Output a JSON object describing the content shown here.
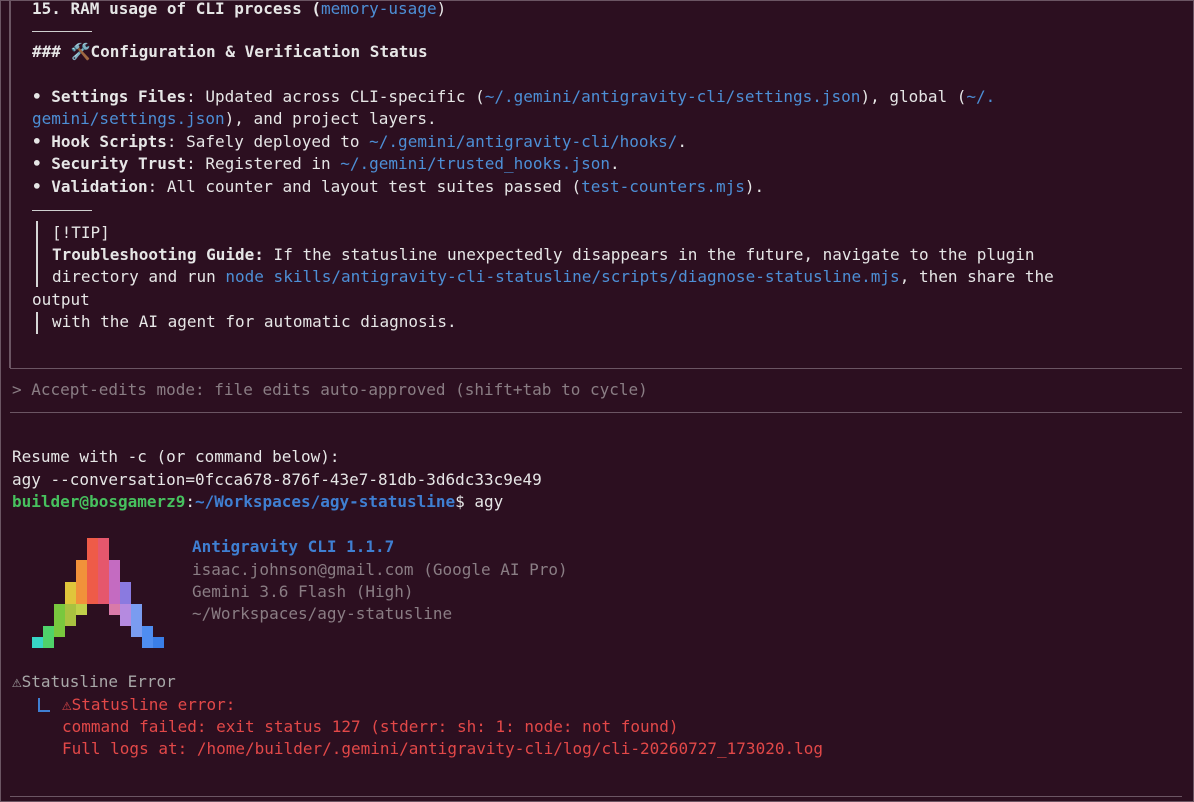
{
  "colors": {
    "background": "#2c0f20",
    "link": "#4d8fd6",
    "prompt_user": "#47c15e",
    "prompt_path": "#3f7fd2",
    "error": "#e24848",
    "dim": "#8a7d84"
  },
  "top": {
    "item15_prefix": "15. RAM usage of CLI process (",
    "item15_link": "memory-usage",
    "item15_suffix": ")"
  },
  "config": {
    "heading": "### 🛠️Configuration & Verification Status",
    "bullets": [
      {
        "label": "• Settings Files",
        "text1": ": Updated across CLI-specific (",
        "link1": "~/.gemini/antigravity-cli/settings.json",
        "text2": "), global (",
        "link2a": "~/.",
        "link2b": "gemini/settings.json",
        "text3": "), and project layers."
      },
      {
        "label": "• Hook Scripts",
        "text1": ": Safely deployed to ",
        "link1": "~/.gemini/antigravity-cli/hooks/",
        "text2": "."
      },
      {
        "label": "• Security Trust",
        "text1": ": Registered in ",
        "link1": "~/.gemini/trusted_hooks.json",
        "text2": "."
      },
      {
        "label": "• Validation",
        "text1": ": All counter and layout test suites passed (",
        "link1": "test-counters.mjs",
        "text2": ")."
      }
    ]
  },
  "tip": {
    "tag": "[!TIP]",
    "label": "Troubleshooting Guide:",
    "line1": " If the statusline unexpectedly disappears in the future, navigate to the plugin",
    "line2_prefix": "directory and run ",
    "line2_link": "node skills/antigravity-cli-statusline/scripts/diagnose-statusline.mjs",
    "line2_suffix": ", then share the",
    "line3": "output",
    "line4": "with the AI agent for automatic diagnosis."
  },
  "mode": {
    "text": "> Accept-edits mode: file edits auto-approved (shift+tab to cycle)"
  },
  "resume": {
    "line1": "Resume with -c (or command below):",
    "line2": "agy --conversation=0fcca678-876f-43e7-81db-3d6dc33c9e49"
  },
  "prompt": {
    "user": "builder@bosgamerz9",
    "colon": ":",
    "path": "~/Workspaces/agy-statusline",
    "dollar": "$ ",
    "command": "agy"
  },
  "banner": {
    "title": "Antigravity CLI 1.1.7",
    "account": "isaac.johnson@gmail.com (Google AI Pro)",
    "model": "Gemini 3.6 Flash (High)",
    "cwd": "~/Workspaces/agy-statusline"
  },
  "error": {
    "title": "⚠Statusline Error",
    "sub_title": "⚠Statusline error:",
    "message": "command failed: exit status 127 (stderr: sh: 1: node: not found)",
    "logs": "Full logs at: /home/builder/.gemini/antigravity-cli/log/cli-20260727_173020.log"
  }
}
